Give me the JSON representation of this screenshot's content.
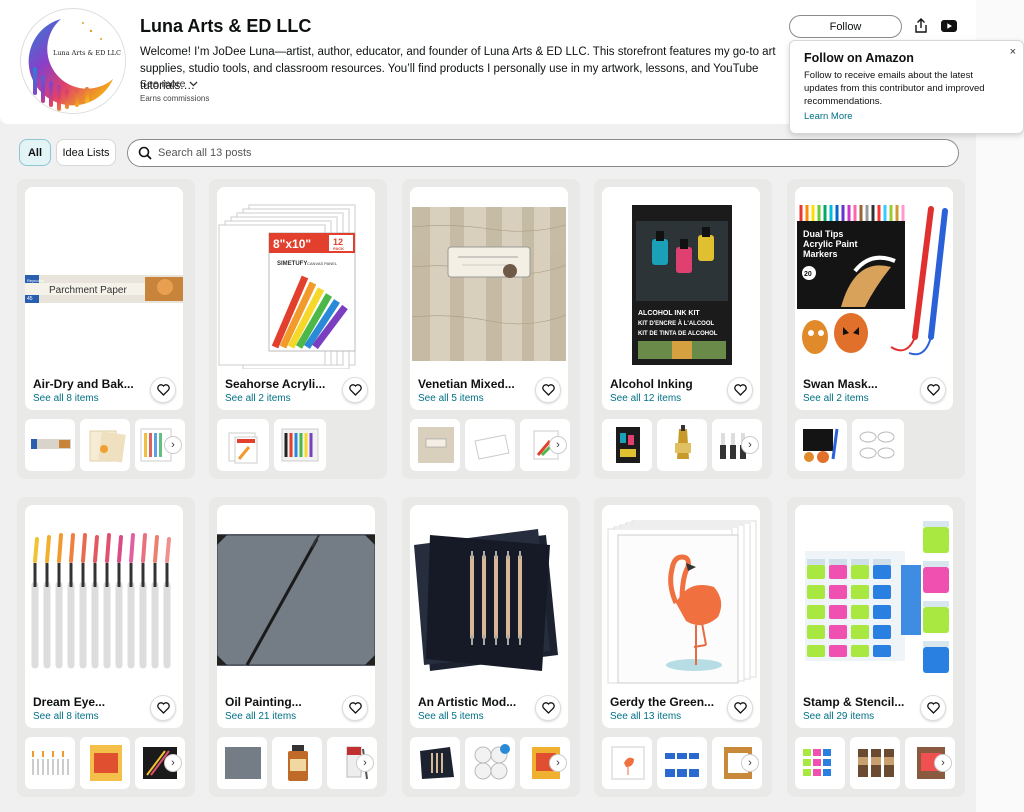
{
  "store": {
    "title": "Luna Arts & ED LLC",
    "logo_text": "Luna Arts & ED LLC",
    "description": "Welcome! I’m JoDee Luna—artist, author, educator, and founder of Luna Arts & ED LLC. This storefront features my go-to art supplies, studio tools, and classroom resources. You’ll find products I personally use in my artwork, lessons, and YouTube tutorials.…",
    "see_more": "See more",
    "earns": "Earns commissions"
  },
  "actions": {
    "follow": "Follow",
    "share_icon": "share-icon",
    "youtube_icon": "youtube-icon"
  },
  "popover": {
    "title": "Follow on Amazon",
    "text": "Follow to receive emails about the latest updates from this contributor and improved recommendations.",
    "link": "Learn More",
    "close": "×"
  },
  "filters": {
    "all": "All",
    "idea_lists": "Idea Lists"
  },
  "search": {
    "placeholder": "Search all 13 posts"
  },
  "colors": {
    "link": "#007185",
    "card_bg": "#e9e9e8",
    "accent_tab": "#e3f4f7"
  },
  "cards": [
    {
      "title": "Air-Dry and Bak...",
      "sub": "See all 8 items"
    },
    {
      "title": "Seahorse Acryli...",
      "sub": "See all 2 items"
    },
    {
      "title": "Venetian Mixed...",
      "sub": "See all 5 items"
    },
    {
      "title": "Alcohol Inking",
      "sub": "See all 12 items"
    },
    {
      "title": "Swan Mask...",
      "sub": "See all 2 items"
    },
    {
      "title": "Dream Eye...",
      "sub": "See all 8 items"
    },
    {
      "title": "Oil Painting...",
      "sub": "See all 21 items"
    },
    {
      "title": "An Artistic Mod...",
      "sub": "See all 5 items"
    },
    {
      "title": "Gerdy the Green...",
      "sub": "See all 13 items"
    },
    {
      "title": "Stamp & Stencil...",
      "sub": "See all 29 items"
    }
  ],
  "image_texts": {
    "parchment": "Parchment Paper",
    "parchment_brand": "Reynolds",
    "parchment_count": "45",
    "canvas_size": "8\"x10\"",
    "canvas_pack": "12",
    "canvas_pack_unit": "PACK",
    "canvas_brand": "SIMETUFY",
    "canvas_panel": "CANVAS PANEL",
    "ink_kit_line1": "ALCOHOL INK KIT",
    "ink_kit_line2": "KIT D'ENCRE À L'ALCOOL",
    "ink_kit_line3": "KIT DE TINTA DE ALCOHOL",
    "markers_line1": "Dual Tips",
    "markers_line2": "Acrylic Paint",
    "markers_line3": "Markers",
    "markers_count": "20"
  }
}
